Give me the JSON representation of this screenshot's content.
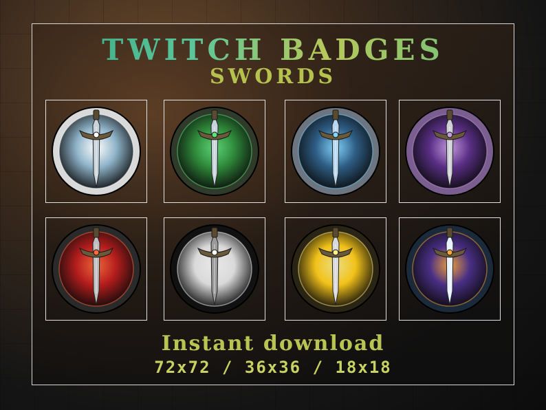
{
  "header": {
    "title": "TWITCH BADGES",
    "subtitle": "SWORDS"
  },
  "badges": [
    {
      "name": "white-silver-sword-badge",
      "ring": "#d9d9d9",
      "inner": "#8fb3c9",
      "accent": "#ffffff",
      "blade": "#c9d3dc"
    },
    {
      "name": "green-emerald-sword-badge",
      "ring": "#2f3a2a",
      "inner": "#2f8a3b",
      "accent": "#5fe07a",
      "blade": "#c9d3dc"
    },
    {
      "name": "blue-steel-sword-badge",
      "ring": "#6c7580",
      "inner": "#2f5e86",
      "accent": "#7fd6ff",
      "blade": "#b9d7ee"
    },
    {
      "name": "purple-amethyst-sword-badge",
      "ring": "#7a5e8f",
      "inner": "#5a2f86",
      "accent": "#c59ae0",
      "blade": "#cfcfd8"
    },
    {
      "name": "red-demon-sword-badge",
      "ring": "#2a2a2a",
      "inner": "#b51d1d",
      "accent": "#ff6a3a",
      "blade": "#bfbfbf"
    },
    {
      "name": "monochrome-ocean-sword-badge",
      "ring": "#111111",
      "inner": "#d9d9d9",
      "accent": "#ffffff",
      "blade": "#9a9a9a"
    },
    {
      "name": "golden-flame-sword-badge",
      "ring": "#2a2414",
      "inner": "#f2c21a",
      "accent": "#fff08a",
      "blade": "#d9d9d9"
    },
    {
      "name": "rainbow-crystal-sword-badge",
      "ring": "#1a2a3a",
      "inner": "#4a2f86",
      "accent": "#ffa83a",
      "blade": "#e9f2ff"
    }
  ],
  "footer": {
    "headline": "Instant download",
    "sizes": "72x72 / 36x36 / 18x18"
  }
}
